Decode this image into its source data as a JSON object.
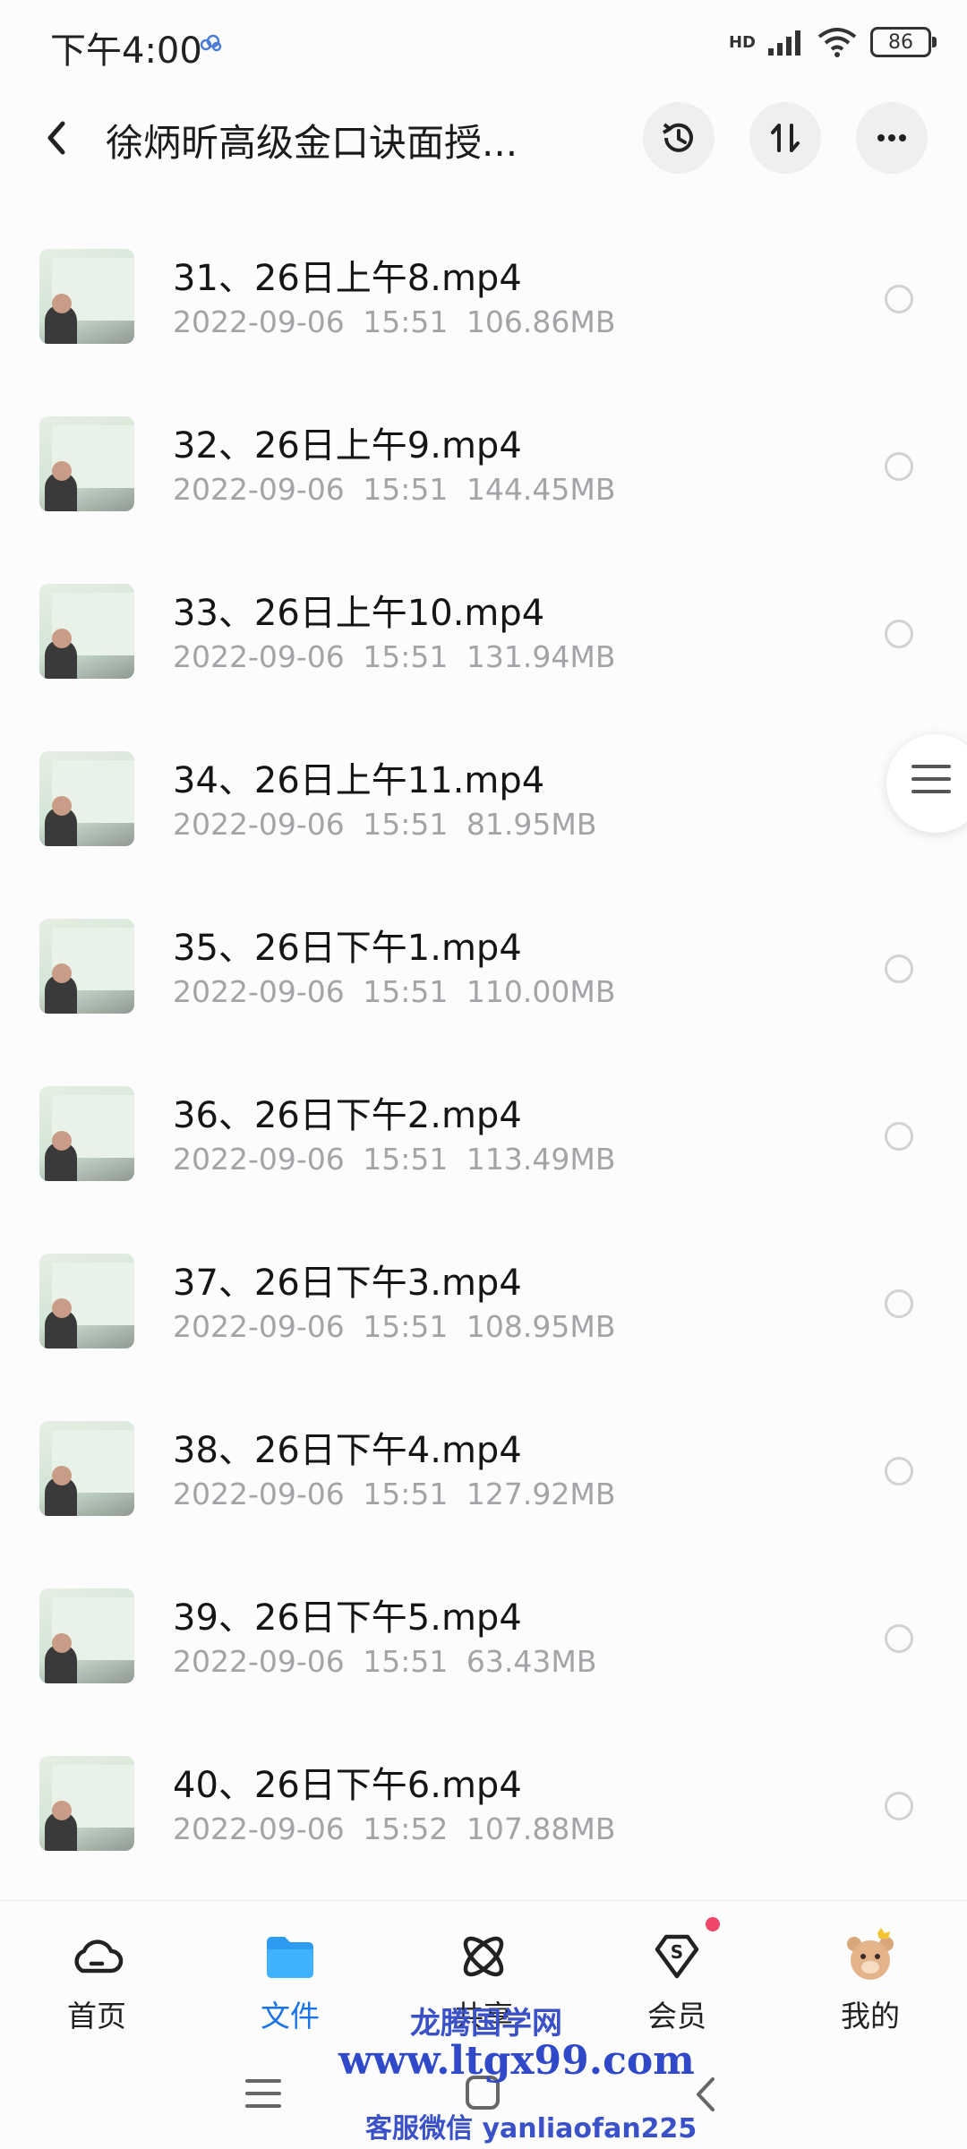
{
  "status_bar": {
    "time": "下午4:00",
    "network": "HD",
    "battery": "86"
  },
  "header": {
    "title": "徐炳昕高级金口诀面授..."
  },
  "files": [
    {
      "name": "31、26日上午8.mp4",
      "date": "2022-09-06",
      "time": "15:51",
      "size": "106.86MB"
    },
    {
      "name": "32、26日上午9.mp4",
      "date": "2022-09-06",
      "time": "15:51",
      "size": "144.45MB"
    },
    {
      "name": "33、26日上午10.mp4",
      "date": "2022-09-06",
      "time": "15:51",
      "size": "131.94MB"
    },
    {
      "name": "34、26日上午11.mp4",
      "date": "2022-09-06",
      "time": "15:51",
      "size": "81.95MB"
    },
    {
      "name": "35、26日下午1.mp4",
      "date": "2022-09-06",
      "time": "15:51",
      "size": "110.00MB"
    },
    {
      "name": "36、26日下午2.mp4",
      "date": "2022-09-06",
      "time": "15:51",
      "size": "113.49MB"
    },
    {
      "name": "37、26日下午3.mp4",
      "date": "2022-09-06",
      "time": "15:51",
      "size": "108.95MB"
    },
    {
      "name": "38、26日下午4.mp4",
      "date": "2022-09-06",
      "time": "15:51",
      "size": "127.92MB"
    },
    {
      "name": "39、26日下午5.mp4",
      "date": "2022-09-06",
      "time": "15:51",
      "size": "63.43MB"
    },
    {
      "name": "40、26日下午6.mp4",
      "date": "2022-09-06",
      "time": "15:52",
      "size": "107.88MB"
    }
  ],
  "bottom_nav": [
    {
      "label": "首页",
      "icon": "cloud-home-icon",
      "active": false
    },
    {
      "label": "文件",
      "icon": "folder-icon",
      "active": true
    },
    {
      "label": "共享",
      "icon": "atom-share-icon",
      "active": false
    },
    {
      "label": "会员",
      "icon": "vip-diamond-icon",
      "active": false,
      "badge": true
    },
    {
      "label": "我的",
      "icon": "bear-avatar-icon",
      "active": false
    }
  ],
  "watermark": {
    "site_name": "龙腾国学网",
    "url": "www.ltgx99.com",
    "contact": "客服微信 yanliaofan225"
  },
  "colors": {
    "accent": "#1a73e8",
    "badge": "#f0466a",
    "meta_text": "#a4a4a8",
    "watermark": "#2f49c9"
  }
}
